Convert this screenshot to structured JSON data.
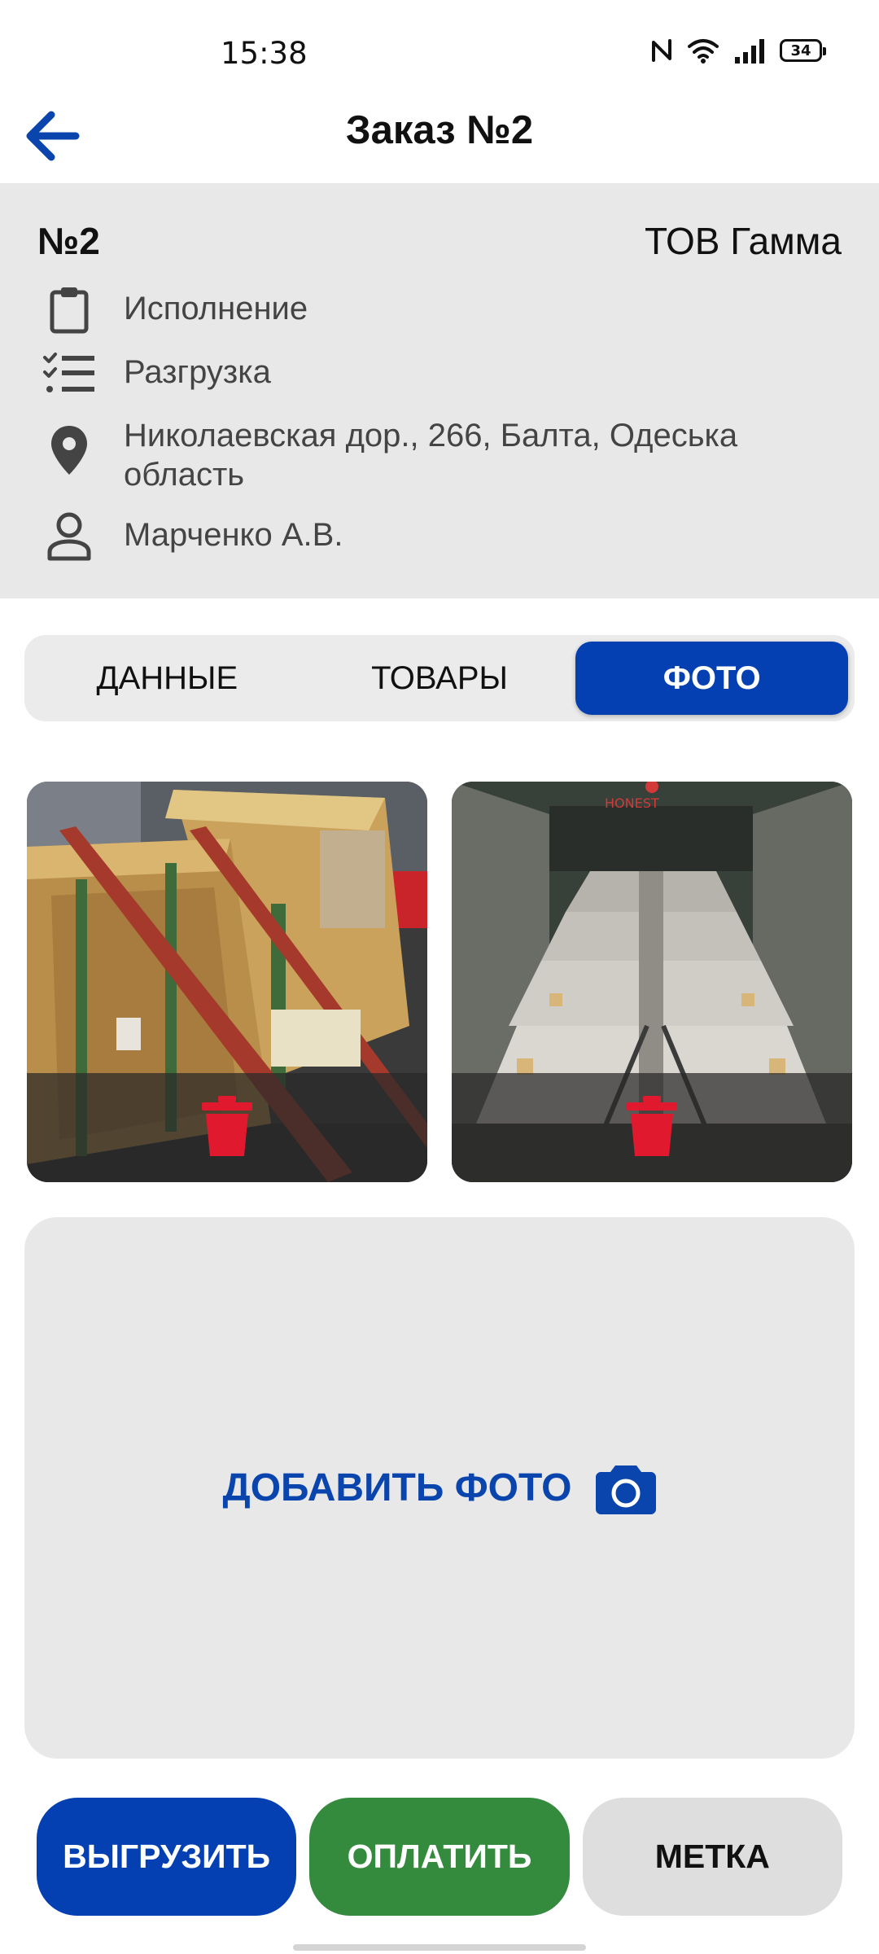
{
  "status_bar": {
    "time": "15:38",
    "battery": "34",
    "icons": [
      "nfc-icon",
      "wifi-icon",
      "signal-icon",
      "battery-icon"
    ]
  },
  "header": {
    "title": "Заказ №2",
    "back_icon": "arrow-left-icon"
  },
  "order": {
    "number": "№2",
    "company": "ТОВ Гамма",
    "status": "Исполнение",
    "operation": "Разгрузка",
    "address": "Николаевская дор., 266, Балта, Одеська область",
    "person": "Марченко А.В."
  },
  "tabs": [
    {
      "label": "ДАННЫЕ",
      "active": false
    },
    {
      "label": "ТОВАРЫ",
      "active": false
    },
    {
      "label": "ФОТО",
      "active": true
    }
  ],
  "photos": [
    {
      "subject": "wooden crates strapped on pallet"
    },
    {
      "subject": "truck trailer loaded with wrapped rolls"
    }
  ],
  "add_photo": {
    "label": "ДОБАВИТЬ ФОТО",
    "icon": "camera-icon"
  },
  "actions": {
    "upload": "ВЫГРУЗИТЬ",
    "pay": "ОПЛАТИТЬ",
    "mark": "МЕТКА"
  },
  "colors": {
    "primary": "#0440b1",
    "success": "#348a3d",
    "delete": "#e0192f",
    "panel": "#e8e8e8"
  }
}
